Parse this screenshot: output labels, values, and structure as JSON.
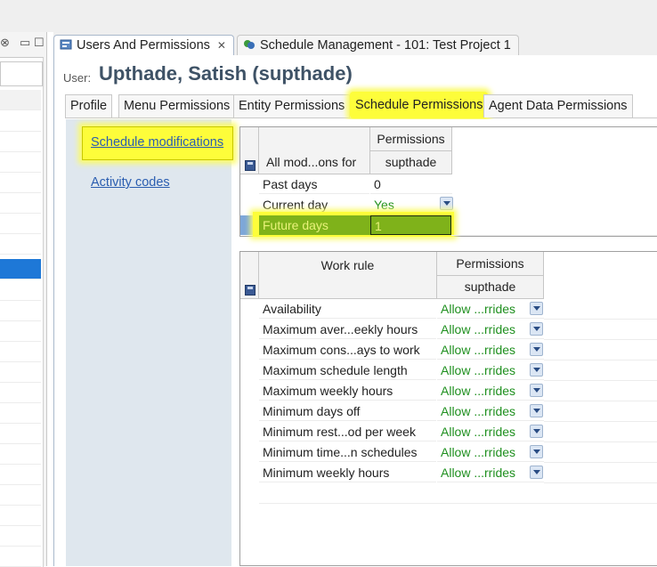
{
  "tabs": {
    "users_permissions": "Users And Permissions",
    "schedule_management": "Schedule Management - 101: Test Project 1"
  },
  "user": {
    "label": "User:",
    "name": "Upthade, Satish (supthade)"
  },
  "subtabs": [
    "Profile",
    "Menu Permissions",
    "Entity Permissions",
    "Schedule Permissions",
    "Agent Data Permissions"
  ],
  "links": {
    "schedule_modifications": "Schedule modifications",
    "activity_codes": "Activity codes"
  },
  "table1": {
    "col1_header": "All mod...ons for",
    "permissions_header": "Permissions",
    "user_header": "supthade",
    "rows": [
      {
        "label": "Past days",
        "value": "0"
      },
      {
        "label": "Current day",
        "value": "Yes"
      },
      {
        "label": "Future days",
        "value": "1"
      }
    ]
  },
  "table2": {
    "col1_header": "Work rule",
    "permissions_header": "Permissions",
    "user_header": "supthade",
    "rows": [
      {
        "label": "Availability",
        "value": "Allow ...rrides"
      },
      {
        "label": "Maximum aver...eekly hours",
        "value": "Allow ...rrides"
      },
      {
        "label": "Maximum cons...ays to work",
        "value": "Allow ...rrides"
      },
      {
        "label": "Maximum schedule length",
        "value": "Allow ...rrides"
      },
      {
        "label": "Maximum weekly hours",
        "value": "Allow ...rrides"
      },
      {
        "label": "Minimum days off",
        "value": "Allow ...rrides"
      },
      {
        "label": "Minimum rest...od per week",
        "value": "Allow ...rrides"
      },
      {
        "label": "Minimum time...n schedules",
        "value": "Allow ...rrides"
      },
      {
        "label": "Minimum weekly hours",
        "value": "Allow ...rrides"
      }
    ]
  },
  "colors": {
    "highlight": "#fdfd3a",
    "selected_row": "#7fb21a",
    "link": "#2a5db0",
    "value_green": "#1e8f1e"
  }
}
